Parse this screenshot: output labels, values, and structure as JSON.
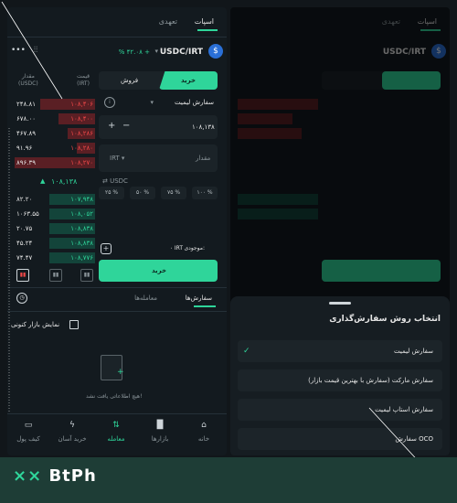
{
  "tabs": {
    "assets": "اسپات",
    "futures": "تعهدی"
  },
  "pair": {
    "name": "USDC/IRT",
    "change": "% ۴۲.۰۸ +",
    "coin_icon": "usdc-coin-icon"
  },
  "orderbook": {
    "header_left": [
      "مقدار",
      "(USDC)"
    ],
    "header_right": [
      "قیمت",
      "(IRT)"
    ],
    "asks": [
      {
        "amount": "۲۴۸.۸۱",
        "price": "۱۰۸,۴۰۶"
      },
      {
        "amount": "۶۷۸.۰۰",
        "price": "۱۰۸,۴۰۰"
      },
      {
        "amount": "۴۶۷.۸۹",
        "price": "۱۰۸,۲۸۶"
      },
      {
        "amount": "۹۱.۹۶",
        "price": "۱۰۸,۲۸۰"
      },
      {
        "amount": "۸۹۶.۳۹",
        "price": "۱۰۸,۲۷۰"
      }
    ],
    "last_price": "۱۰۸,۱۳۸",
    "bids": [
      {
        "amount": "۸۲.۲۰",
        "price": "۱۰۷,۹۴۸"
      },
      {
        "amount": "۱۰۶۳.۵۵",
        "price": "۱۰۸,۰۵۲"
      },
      {
        "amount": "۲۰.۷۵",
        "price": "۱۰۸,۸۳۸"
      },
      {
        "amount": "۴۵.۲۴",
        "price": "۱۰۸,۸۳۸"
      },
      {
        "amount": "۷۴.۴۷",
        "price": "۱۰۸,۷۷۶"
      }
    ]
  },
  "trade": {
    "buy": "خرید",
    "sell": "فروش",
    "order_type": "سفارش لیمیت",
    "price_value": "۱۰۸,۱۳۸",
    "currency_irt": "IRT",
    "amount_placeholder": "مقدار",
    "currency_usdc": "USDC",
    "pcts": [
      "۲۵ %",
      "۵۰ %",
      "۷۵ %",
      "۱۰۰ %"
    ],
    "balance_label": "موجودی:",
    "balance_value": "۰ IRT",
    "submit": "خرید"
  },
  "orders": {
    "my_orders": "سفارش‌ها",
    "trades": "معامله‌ها",
    "show_current": "نمایش بازار کنونی",
    "empty": "هیچ اطلاعاتی یافت نشد!"
  },
  "nav": [
    {
      "label": "خانه",
      "icon": "home-icon"
    },
    {
      "label": "بازارها",
      "icon": "markets-icon"
    },
    {
      "label": "معامله",
      "icon": "trade-icon"
    },
    {
      "label": "خرید آسان",
      "icon": "easy-buy-icon"
    },
    {
      "label": "کیف پول",
      "icon": "wallet-icon"
    }
  ],
  "sheet": {
    "title": "انتخاب روش سفارش‌گذاری",
    "options": [
      "سفارش لیمیت",
      "سفارش مارکت (سفارش با بهترین قیمت بازار)",
      "سفارش استاپ‌ لیمیت",
      "سفارش OCO"
    ]
  },
  "brand": {
    "name": "BtPh",
    "accent": "#2fd59a"
  }
}
